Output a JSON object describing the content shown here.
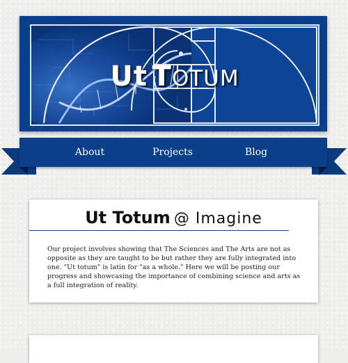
{
  "banner": {
    "title_first": "Ut",
    "title_second": "Totum",
    "colors": {
      "navy": "#0b3f8a",
      "frame": "#dfe8f5"
    },
    "image_icon": "golden-spiral-dna-icon"
  },
  "nav": {
    "items": [
      {
        "label": "About"
      },
      {
        "label": "Projects"
      },
      {
        "label": "Blog"
      }
    ]
  },
  "posts": [
    {
      "title_bold": "Ut Totum",
      "title_rest": "@ Imagine",
      "body": "Our project involves showing that The Sciences and The Arts are not as opposite as they are taught to be but rather they are fully integrated into one. \"Ut totum\" is latin for \"as a whole.\" Here we will be posting our progress and showcasing the importance of combining science and arts as a full integration of reality."
    }
  ]
}
